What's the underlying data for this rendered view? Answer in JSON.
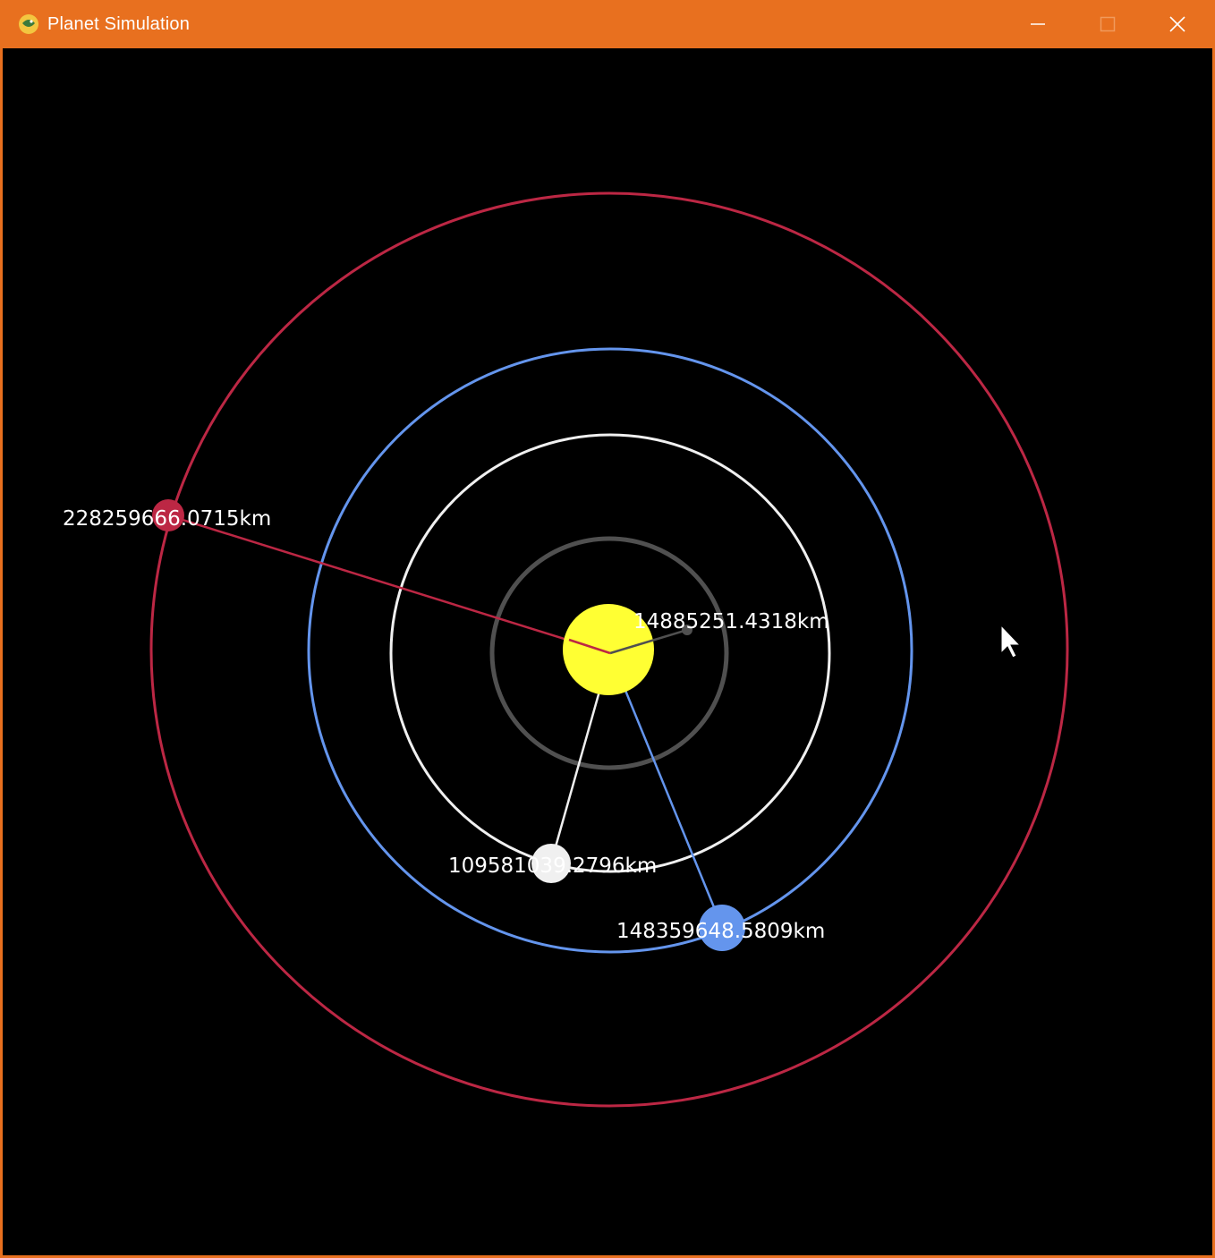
{
  "window": {
    "title": "Planet Simulation",
    "titlebar_color": "#e8701f",
    "controls": [
      "minimize-icon",
      "maximize-icon",
      "close-icon"
    ]
  },
  "simulation": {
    "background": "#000000",
    "sun": {
      "name": "sun",
      "color": "#ffff33"
    },
    "planets": [
      {
        "name": "mercury",
        "color": "#505050",
        "distance_label": "14885251.4318km"
      },
      {
        "name": "venus",
        "color": "#f0f0f0",
        "distance_label": "109581039.2796km"
      },
      {
        "name": "earth",
        "color": "#6495ed",
        "distance_label": "148359648.5809km"
      },
      {
        "name": "mars",
        "color": "#bc2744",
        "distance_label": "228259666.0715km"
      }
    ]
  }
}
